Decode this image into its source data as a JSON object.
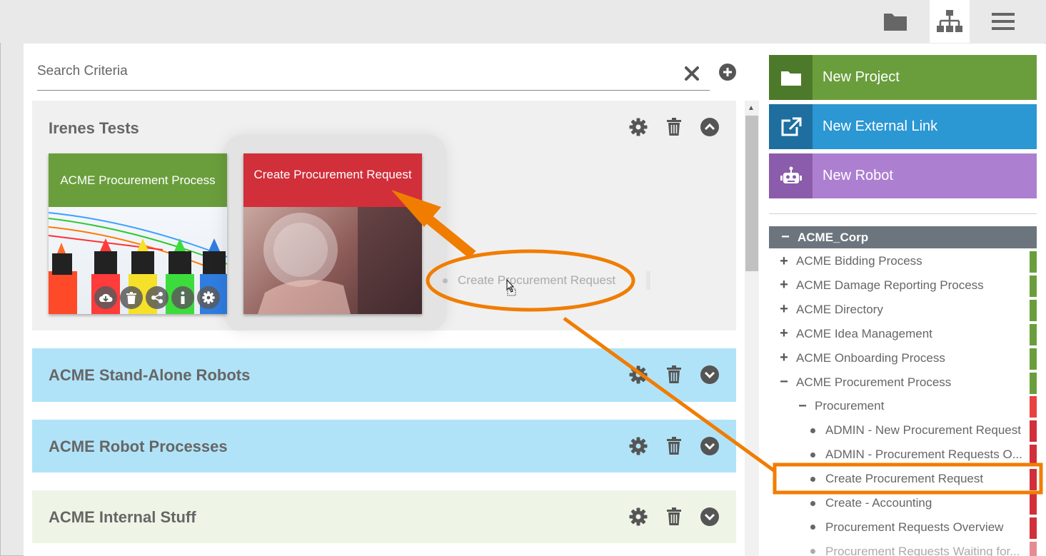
{
  "topbar": {
    "icons": [
      "folder-icon",
      "sitemap-icon",
      "menu-icon"
    ],
    "active": "sitemap-icon"
  },
  "search": {
    "placeholder": "Search Criteria",
    "value": ""
  },
  "sections": [
    {
      "title": "Irenes Tests",
      "color": "#f0f0f0",
      "expanded": true,
      "tiles": [
        {
          "label": "ACME Procurement Process",
          "color": "#6a9e3c"
        },
        {
          "label": "Create Procurement Request",
          "color": "#d12f3a"
        }
      ]
    },
    {
      "title": "ACME Stand-Alone Robots",
      "color": "#b1e3f8",
      "expanded": false
    },
    {
      "title": "ACME Robot Processes",
      "color": "#b1e3f8",
      "expanded": false
    },
    {
      "title": "ACME Internal Stuff",
      "color": "#eef5e6",
      "expanded": false
    }
  ],
  "drag_ghost_label": "Create Procurement Request",
  "actions": [
    {
      "label": "New Project",
      "color": "#6a9e3c",
      "icon_bg": "#4d7a2a",
      "icon": "folder-icon"
    },
    {
      "label": "New External Link",
      "color": "#2b97d3",
      "icon_bg": "#1e6fa0",
      "icon": "external-link-icon"
    },
    {
      "label": "New Robot",
      "color": "#ad7fd1",
      "icon_bg": "#8a5cab",
      "icon": "robot-icon"
    }
  ],
  "tree": {
    "root": "ACME_Corp",
    "items": [
      {
        "label": "ACME Bidding Process",
        "level": 0,
        "toggle": "+",
        "marker": "#6a9e3c"
      },
      {
        "label": "ACME Damage Reporting Process",
        "level": 0,
        "toggle": "+",
        "marker": "#6a9e3c"
      },
      {
        "label": "ACME Directory",
        "level": 0,
        "toggle": "+",
        "marker": "#6a9e3c"
      },
      {
        "label": "ACME Idea Management",
        "level": 0,
        "toggle": "+",
        "marker": "#6a9e3c"
      },
      {
        "label": "ACME Onboarding Process",
        "level": 0,
        "toggle": "+",
        "marker": "#6a9e3c"
      },
      {
        "label": "ACME Procurement Process",
        "level": 0,
        "toggle": "−",
        "marker": "#6a9e3c"
      },
      {
        "label": "Procurement",
        "level": 1,
        "toggle": "−",
        "marker": "#e84141"
      },
      {
        "label": "ADMIN - New Procurement Request",
        "level": 2,
        "toggle": "•",
        "marker": "#d12f3a"
      },
      {
        "label": "ADMIN - Procurement Requests O...",
        "level": 2,
        "toggle": "•",
        "marker": "#d12f3a"
      },
      {
        "label": "Create Procurement Request",
        "level": 2,
        "toggle": "•",
        "marker": "#d12f3a",
        "highlight": true
      },
      {
        "label": "Create - Accounting",
        "level": 2,
        "toggle": "•",
        "marker": "#d12f3a"
      },
      {
        "label": "Procurement Requests Overview",
        "level": 2,
        "toggle": "•",
        "marker": "#d12f3a"
      },
      {
        "label": "Procurement Requests Waiting for...",
        "level": 2,
        "toggle": "•",
        "marker": "#d12f3a"
      }
    ]
  },
  "annotation_color": "#f07d00"
}
